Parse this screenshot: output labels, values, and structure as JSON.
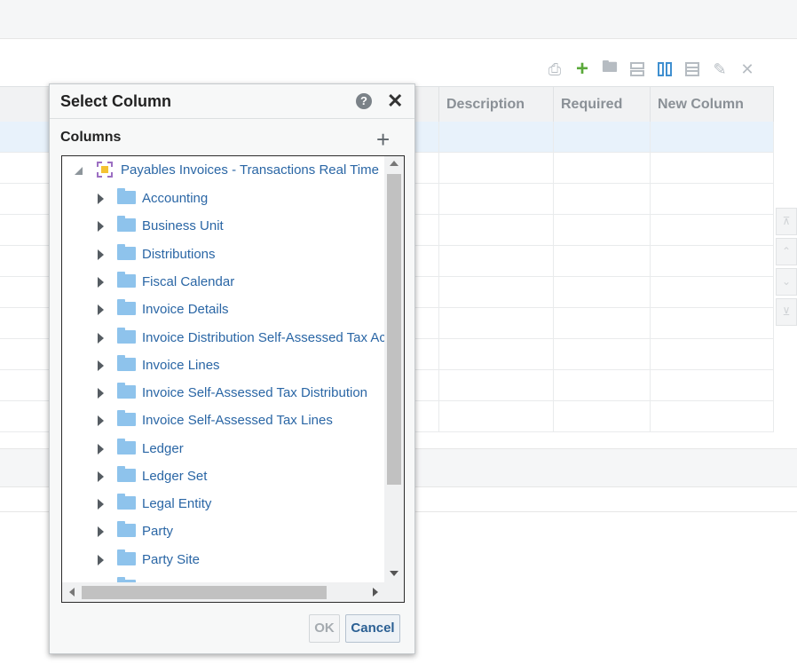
{
  "grid": {
    "headers": [
      "Description",
      "Required",
      "New Column"
    ]
  },
  "toolbar": {
    "icons": [
      "print-icon",
      "add-icon",
      "folder-icon",
      "rows-icon",
      "columns-icon",
      "detach-icon",
      "edit-icon",
      "delete-icon"
    ],
    "add_label": "+",
    "delete_label": "✕"
  },
  "dialog": {
    "title": "Select Column",
    "help_label": "?",
    "close_label": "✕",
    "columns_label": "Columns",
    "add_label": "+",
    "root_label": "Payables Invoices - Transactions Real Time",
    "tree_items": [
      "Accounting",
      "Business Unit",
      "Distributions",
      "Fiscal Calendar",
      "Invoice Details",
      "Invoice Distribution Self-Assessed Tax Ac",
      "Invoice Lines",
      "Invoice Self-Assessed Tax Distribution",
      "Invoice Self-Assessed Tax Lines",
      "Ledger",
      "Ledger Set",
      "Legal Entity",
      "Party",
      "Party Site"
    ],
    "ok_label": "OK",
    "cancel_label": "Cancel"
  },
  "colors": {
    "link": "#2a66a5",
    "folder": "#8ec3ec",
    "selected_row": "#e8f2fb"
  }
}
